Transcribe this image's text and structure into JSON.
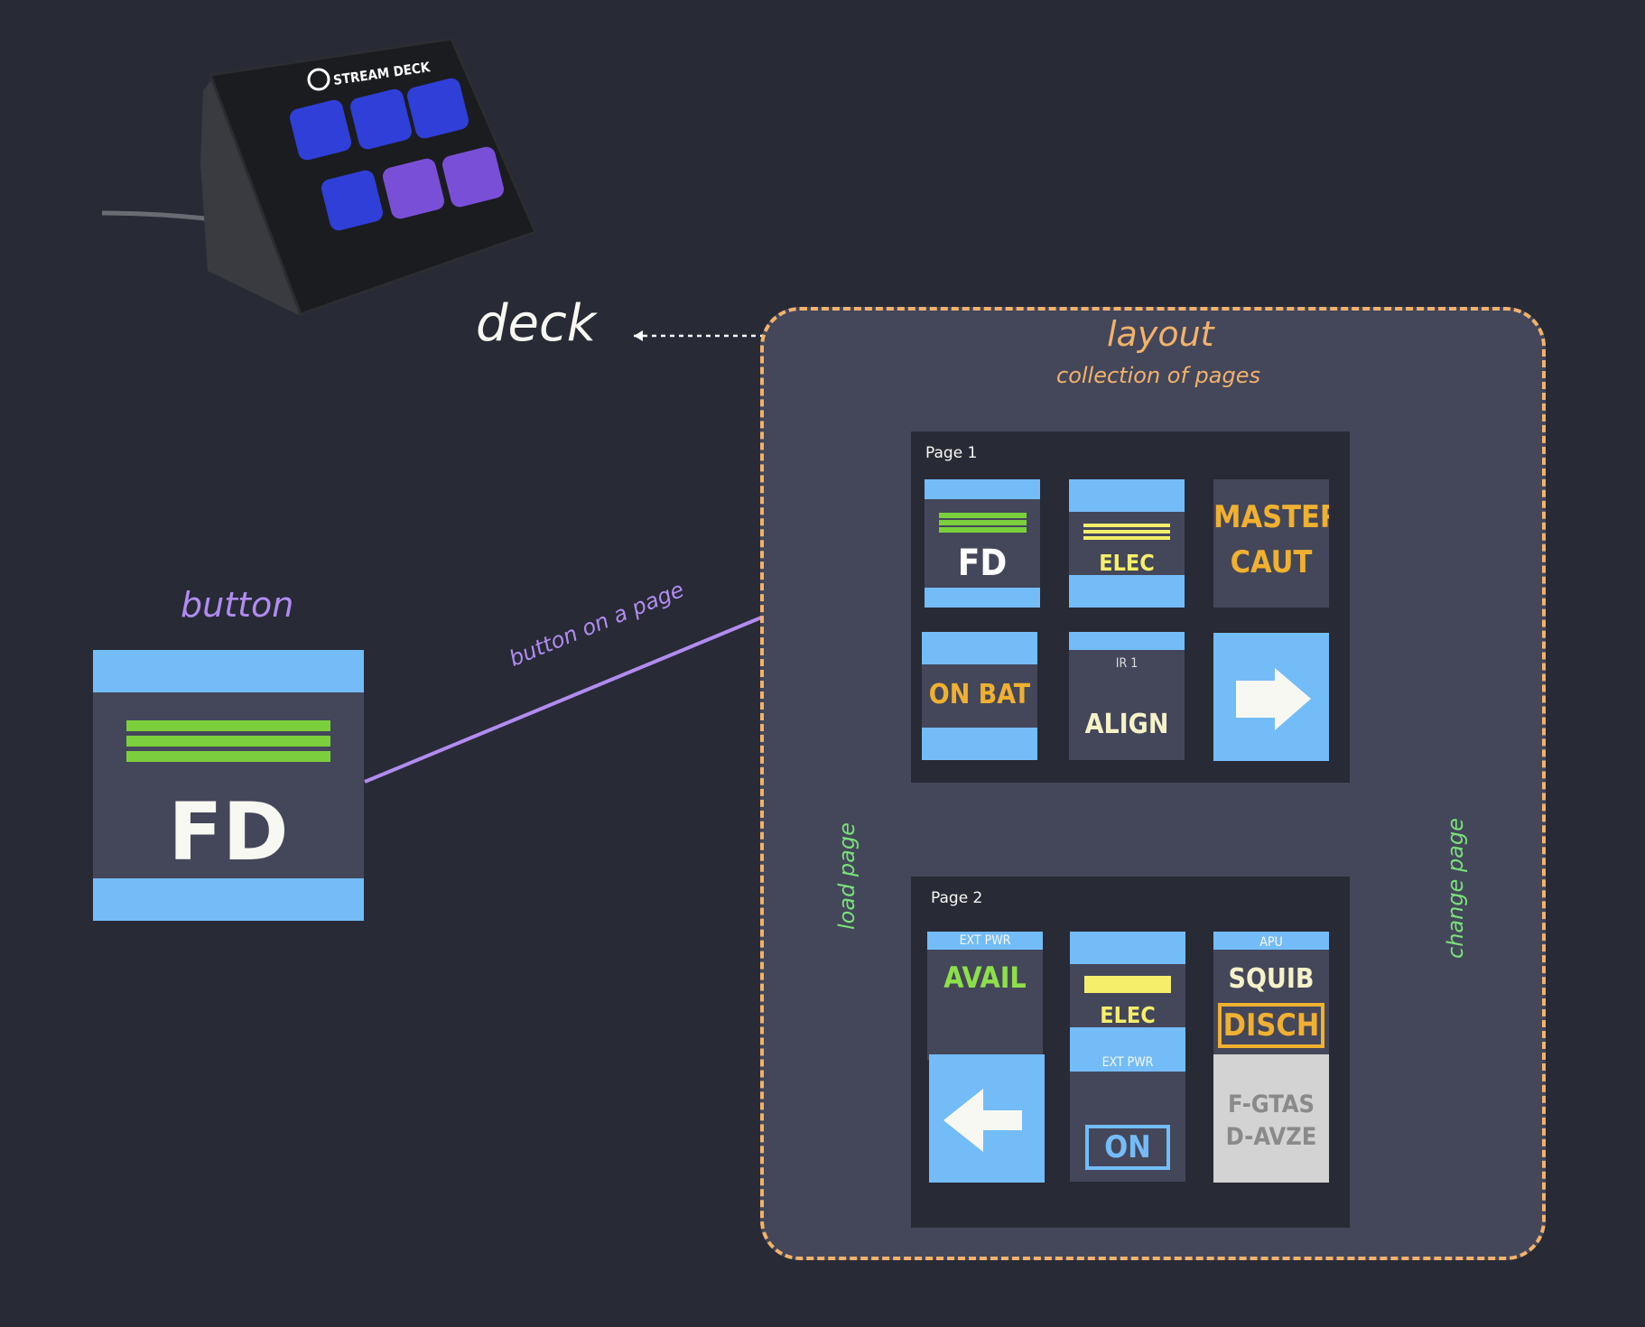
{
  "colors": {
    "background": "#282a36",
    "panel": "#44475a",
    "blue": "#74bcf8",
    "green": "#7ae07a",
    "purple": "#b18cf0",
    "orange": "#f2b26b",
    "amber": "#f0b030",
    "yellow": "#f5ee6a"
  },
  "device": {
    "logo_text": "STREAM DECK"
  },
  "labels": {
    "deck": "deck",
    "layout": "layout",
    "layout_sub": "collection of pages",
    "button": "button",
    "button_on_page": "button on a page",
    "load_page": "load page",
    "change_page": "change page"
  },
  "sample_button": {
    "label": "FD"
  },
  "page1": {
    "title": "Page 1",
    "buttons": {
      "fd": "FD",
      "elec": "ELEC",
      "master": "MASTER",
      "caut": "CAUT",
      "onbat": "ON BAT",
      "ir_top": "IR 1",
      "align": "ALIGN",
      "next": "arrow-right-icon"
    }
  },
  "page2": {
    "title": "Page 2",
    "buttons": {
      "ext_top": "EXT PWR",
      "avail": "AVAIL",
      "elec": "ELEC",
      "apu_top": "APU",
      "squib": "SQUIB",
      "disch": "DISCH",
      "back": "arrow-left-icon",
      "ext2_top": "EXT PWR",
      "on": "ON",
      "fgtas": "F-GTAS",
      "davze": "D-AVZE"
    }
  }
}
